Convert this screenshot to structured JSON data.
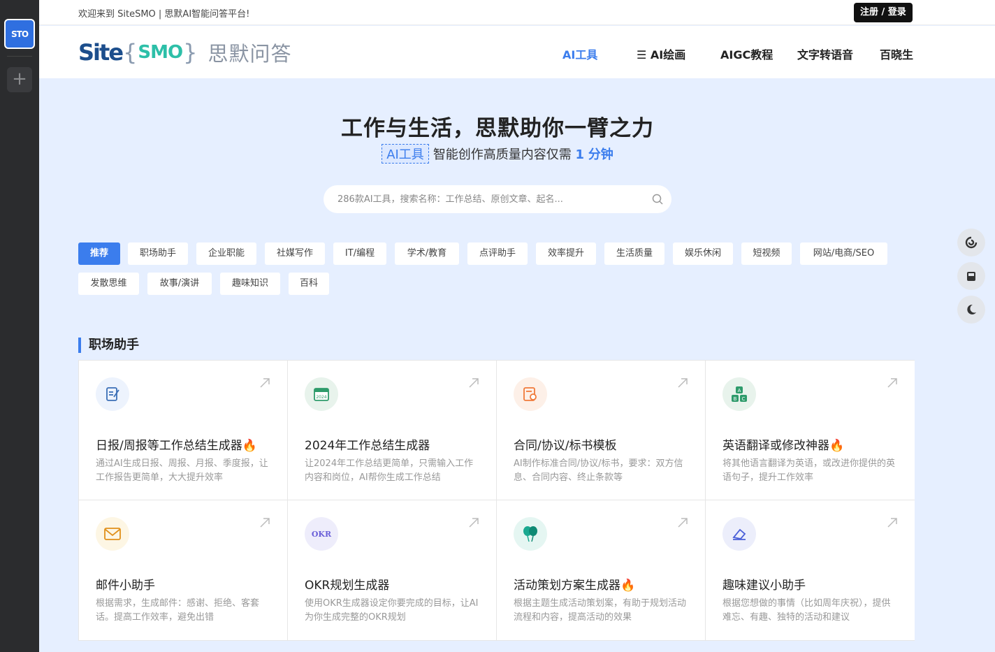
{
  "rail": {
    "app_label": "STO",
    "add_label": "+"
  },
  "topbar": {
    "welcome": "欢迎来到 SiteSMO | 思默AI智能问答平台!",
    "login": "注册 / 登录"
  },
  "header": {
    "logo": {
      "site": "Site",
      "brace_open": "{",
      "smo": "SMO",
      "brace_close": "}",
      "cn": "思默问答"
    },
    "nav": [
      "AI工具",
      "☰ AI绘画",
      "AIGC教程",
      "文字转语音",
      "百晓生"
    ]
  },
  "hero": {
    "title": "工作与生活，思默助你一臂之力",
    "tag": "AI工具",
    "sub_text": "智能创作高质量内容仅需",
    "sub_num": "1",
    "sub_unit": "分钟"
  },
  "search": {
    "placeholder": "286款AI工具，搜索名称：工作总结、原创文章、起名..."
  },
  "categories": [
    "推荐",
    "职场助手",
    "企业职能",
    "社媒写作",
    "IT/编程",
    "学术/教育",
    "点评助手",
    "效率提升",
    "生活质量",
    "娱乐休闲",
    "短视频",
    "网站/电商/SEO",
    "发散思维",
    "故事/演讲",
    "趣味知识",
    "百科"
  ],
  "section": {
    "title": "职场助手"
  },
  "cards": [
    {
      "title": "日报/周报等工作总结生成器🔥",
      "desc": "通过AI生成日报、周报、月报、季度报，让工作报告更简单，大大提升效率",
      "icon": "edit-doc-icon",
      "color": "#3b7ded"
    },
    {
      "title": "2024年工作总结生成器",
      "desc": "让2024年工作总结更简单，只需输入工作内容和岗位，AI帮你生成工作总结",
      "icon": "calendar-2024-icon",
      "color": "#2e9b6b"
    },
    {
      "title": "合同/协议/标书模板",
      "desc": "AI制作标准合同/协议/标书，要求：双方信息、合同内容、终止条款等",
      "icon": "contract-icon",
      "color": "#f07a3a"
    },
    {
      "title": "英语翻译或修改神器🔥",
      "desc": "将其他语言翻译为英语，或改进你提供的英语句子，提升工作效率",
      "icon": "abc-blocks-icon",
      "color": "#2e9b6b"
    },
    {
      "title": "邮件小助手",
      "desc": "根据需求，生成邮件：感谢、拒绝、客套话。提高工作效率，避免出错",
      "icon": "mail-icon",
      "color": "#f0a020"
    },
    {
      "title": "OKR规划生成器",
      "desc": "使用OKR生成器设定你要完成的目标，让AI为你生成完整的OKR规划",
      "icon": "okr-icon",
      "color": "#6a5fd8"
    },
    {
      "title": "活动策划方案生成器🔥",
      "desc": "根据主题生成活动策划案，有助于规划活动流程和内容，提高活动的效果",
      "icon": "balloons-icon",
      "color": "#1aa890"
    },
    {
      "title": "趣味建议小助手",
      "desc": "根据您想做的事情（比如周年庆祝），提供难忘、有趣、独特的活动和建议",
      "icon": "eraser-icon",
      "color": "#4a5fd8"
    }
  ]
}
